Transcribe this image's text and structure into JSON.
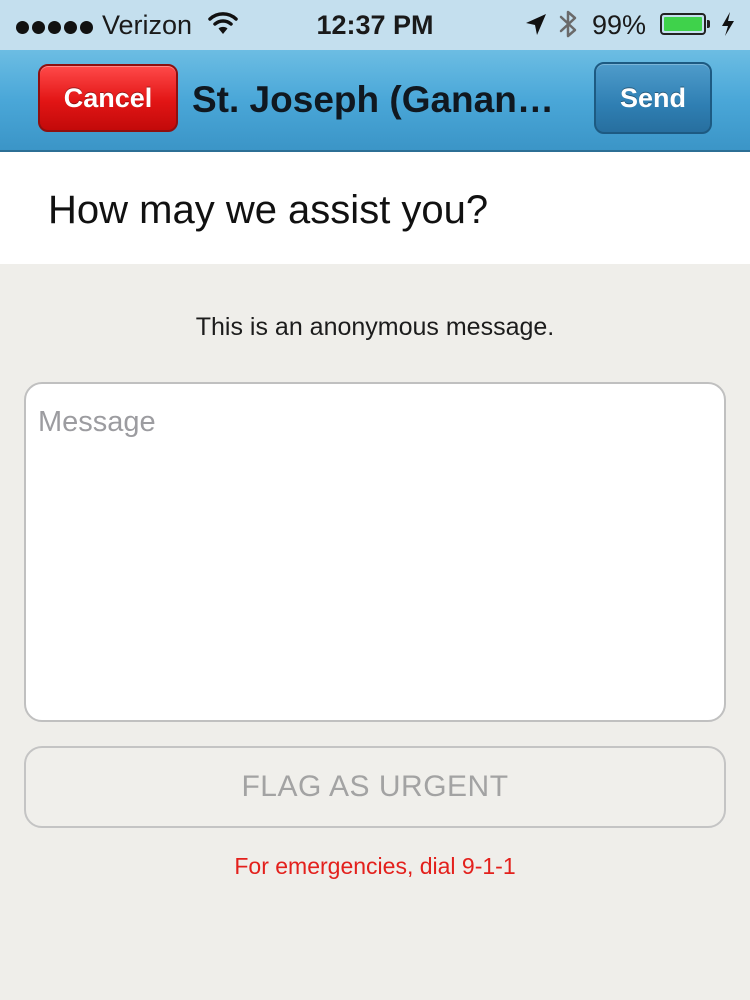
{
  "status_bar": {
    "signal_dots": 5,
    "carrier": "Verizon",
    "time": "12:37 PM",
    "battery_percent": "99%",
    "battery_level": 0.99,
    "icons": [
      "wifi-icon",
      "location-arrow-icon",
      "bluetooth-icon",
      "battery-icon",
      "charging-bolt-icon"
    ]
  },
  "nav": {
    "cancel_label": "Cancel",
    "title": "St. Joseph (Ganan…",
    "send_label": "Send"
  },
  "header": {
    "title": "How may we assist you?"
  },
  "form": {
    "anonymous_note": "This is an anonymous message.",
    "message_placeholder": "Message",
    "message_value": "",
    "urgent_label": "FLAG AS URGENT",
    "emergency_note": "For emergencies, dial 9-1-1"
  },
  "colors": {
    "nav_blue": "#4aa7d8",
    "cancel_red": "#e21515",
    "send_blue": "#2f7fb3",
    "emergency_red": "#e3201c",
    "battery_green": "#3fd24b"
  }
}
